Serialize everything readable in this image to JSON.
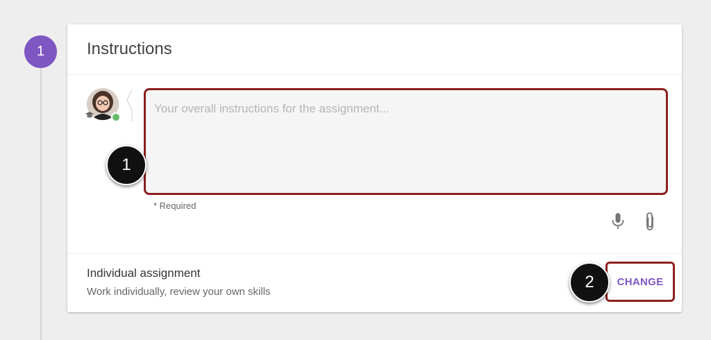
{
  "step": {
    "number": "1"
  },
  "card": {
    "title": "Instructions",
    "instructions_placeholder": "Your overall instructions for the assignment...",
    "instructions_value": "",
    "required_note": "* Required",
    "assignment_type": {
      "title": "Individual assignment",
      "subtitle": "Work individually, review your own skills",
      "change_label": "CHANGE"
    }
  },
  "callouts": {
    "first": "1",
    "second": "2"
  },
  "icons": {
    "microphone": "microphone-icon",
    "attachment": "paperclip-icon",
    "role_badge": "graduation-cap-icon"
  },
  "colors": {
    "accent": "#7e57c2",
    "highlight_border": "#8b1f1f",
    "online": "#66bb6a",
    "callout_bg": "#111111"
  }
}
